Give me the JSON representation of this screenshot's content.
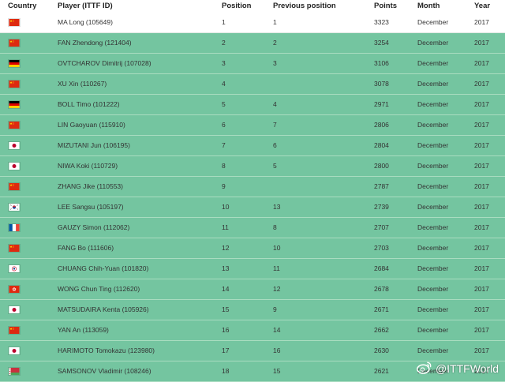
{
  "table": {
    "headers": {
      "country": "Country",
      "player": "Player (ITTF ID)",
      "position": "Position",
      "previous": "Previous position",
      "points": "Points",
      "month": "Month",
      "year": "Year"
    },
    "rows": [
      {
        "flag": "china",
        "player": "MA Long (105649)",
        "position": "1",
        "previous": "1",
        "points": "3323",
        "month": "December",
        "year": "2017"
      },
      {
        "flag": "china",
        "player": "FAN Zhendong (121404)",
        "position": "2",
        "previous": "2",
        "points": "3254",
        "month": "December",
        "year": "2017"
      },
      {
        "flag": "germany",
        "player": "OVTCHAROV Dimitrij (107028)",
        "position": "3",
        "previous": "3",
        "points": "3106",
        "month": "December",
        "year": "2017"
      },
      {
        "flag": "china",
        "player": "XU Xin (110267)",
        "position": "4",
        "previous": "",
        "points": "3078",
        "month": "December",
        "year": "2017"
      },
      {
        "flag": "germany",
        "player": "BOLL Timo (101222)",
        "position": "5",
        "previous": "4",
        "points": "2971",
        "month": "December",
        "year": "2017"
      },
      {
        "flag": "china",
        "player": "LIN Gaoyuan (115910)",
        "position": "6",
        "previous": "7",
        "points": "2806",
        "month": "December",
        "year": "2017"
      },
      {
        "flag": "japan",
        "player": "MIZUTANI Jun (106195)",
        "position": "7",
        "previous": "6",
        "points": "2804",
        "month": "December",
        "year": "2017"
      },
      {
        "flag": "japan",
        "player": "NIWA Koki (110729)",
        "position": "8",
        "previous": "5",
        "points": "2800",
        "month": "December",
        "year": "2017"
      },
      {
        "flag": "china",
        "player": "ZHANG Jike (110553)",
        "position": "9",
        "previous": "",
        "points": "2787",
        "month": "December",
        "year": "2017"
      },
      {
        "flag": "korea",
        "player": "LEE Sangsu (105197)",
        "position": "10",
        "previous": "13",
        "points": "2739",
        "month": "December",
        "year": "2017"
      },
      {
        "flag": "france",
        "player": "GAUZY Simon (112062)",
        "position": "11",
        "previous": "8",
        "points": "2707",
        "month": "December",
        "year": "2017"
      },
      {
        "flag": "china",
        "player": "FANG Bo (111606)",
        "position": "12",
        "previous": "10",
        "points": "2703",
        "month": "December",
        "year": "2017"
      },
      {
        "flag": "chinese-taipei",
        "player": "CHUANG Chih-Yuan (101820)",
        "position": "13",
        "previous": "11",
        "points": "2684",
        "month": "December",
        "year": "2017"
      },
      {
        "flag": "hong-kong",
        "player": "WONG Chun Ting (112620)",
        "position": "14",
        "previous": "12",
        "points": "2678",
        "month": "December",
        "year": "2017"
      },
      {
        "flag": "japan",
        "player": "MATSUDAIRA Kenta (105926)",
        "position": "15",
        "previous": "9",
        "points": "2671",
        "month": "December",
        "year": "2017"
      },
      {
        "flag": "china",
        "player": "YAN An (113059)",
        "position": "16",
        "previous": "14",
        "points": "2662",
        "month": "December",
        "year": "2017"
      },
      {
        "flag": "japan",
        "player": "HARIMOTO Tomokazu (123980)",
        "position": "17",
        "previous": "16",
        "points": "2630",
        "month": "December",
        "year": "2017"
      },
      {
        "flag": "belarus",
        "player": "SAMSONOV Vladimir (108246)",
        "position": "18",
        "previous": "15",
        "points": "2621",
        "month": "December",
        "year": "2017"
      }
    ]
  },
  "watermark": {
    "text": "@ITTFWorld",
    "icon": "weibo-icon"
  },
  "colors": {
    "row_alt": "#74c5a0",
    "row_first": "#ffffff",
    "header_bg": "#ffffff"
  }
}
